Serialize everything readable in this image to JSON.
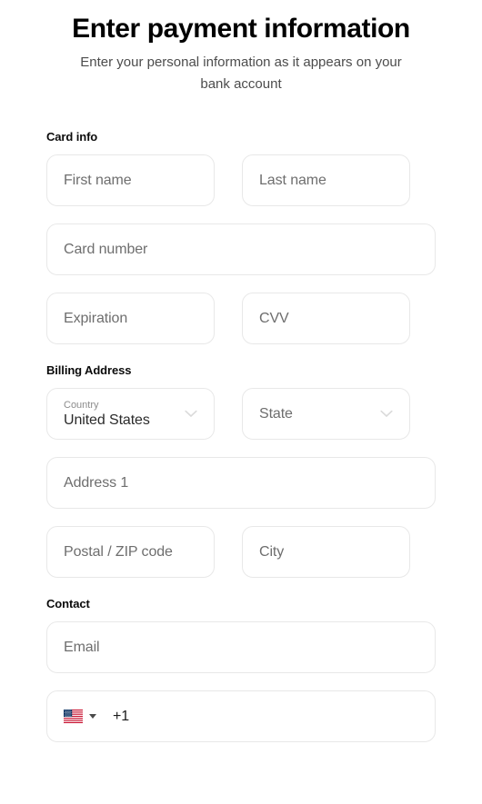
{
  "header": {
    "title": "Enter payment information",
    "subtitle": "Enter your personal information as it appears on your bank account"
  },
  "sections": {
    "card_info": {
      "title": "Card info",
      "fields": {
        "first_name": {
          "placeholder": "First name",
          "value": ""
        },
        "last_name": {
          "placeholder": "Last name",
          "value": ""
        },
        "card_number": {
          "placeholder": "Card number",
          "value": ""
        },
        "expiration": {
          "placeholder": "Expiration",
          "value": ""
        },
        "cvv": {
          "placeholder": "CVV",
          "value": ""
        }
      }
    },
    "billing_address": {
      "title": "Billing Address",
      "fields": {
        "country": {
          "label": "Country",
          "value": "United States",
          "icon": "chevron-down-icon"
        },
        "state": {
          "placeholder": "State",
          "value": "",
          "icon": "chevron-down-icon"
        },
        "address1": {
          "placeholder": "Address 1",
          "value": ""
        },
        "postal_code": {
          "placeholder": "Postal / ZIP code",
          "value": ""
        },
        "city": {
          "placeholder": "City",
          "value": ""
        }
      }
    },
    "contact": {
      "title": "Contact",
      "fields": {
        "email": {
          "placeholder": "Email",
          "value": ""
        },
        "phone": {
          "country_flag": "us-flag-icon",
          "caret": "caret-down-icon",
          "dial_code": "+1",
          "value": ""
        }
      }
    }
  },
  "colors": {
    "background": "#ffffff",
    "title": "#000000",
    "subtitle": "#4c4c4c",
    "section_title": "#0b0b0b",
    "placeholder": "#6e6e6e",
    "float_label": "#8c8c8c",
    "value_text": "#2b2b2b",
    "field_border": "#e8e8e8",
    "chevron": "#dadada"
  }
}
